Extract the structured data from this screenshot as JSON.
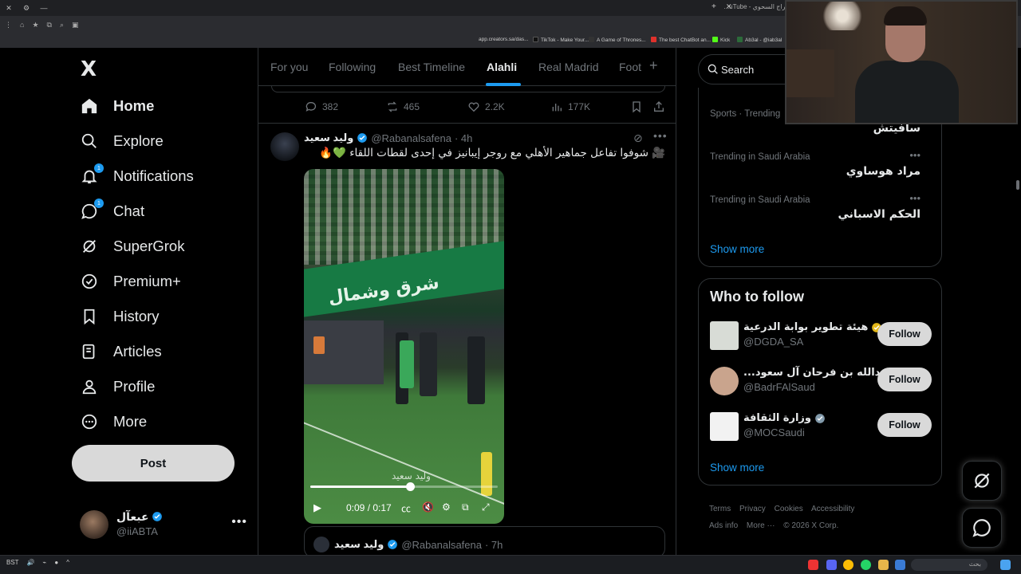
{
  "browser": {
    "window_title": "...uTube - حراج السحوي",
    "bookmarks": [
      {
        "label": "app.creators.sa/das...",
        "color": "#3b3f46"
      },
      {
        "label": "TikTok - Make Your...",
        "color": "#111111"
      },
      {
        "label": "A Game of Thrones...",
        "color": "#222222"
      },
      {
        "label": "The best ChatBot an...",
        "color": "#e0312b"
      },
      {
        "label": "Kick",
        "color": "#53fc18"
      },
      {
        "label": "Ab3al - @iab3al",
        "color": "#2c6b3a"
      }
    ]
  },
  "nav": {
    "logo": "X",
    "items": [
      {
        "label": "Home",
        "icon": "home-icon",
        "badge": ""
      },
      {
        "label": "Explore",
        "icon": "search-icon",
        "badge": ""
      },
      {
        "label": "Notifications",
        "icon": "bell-icon",
        "badge": "1"
      },
      {
        "label": "Chat",
        "icon": "chat-icon",
        "badge": "1"
      },
      {
        "label": "SuperGrok",
        "icon": "grok-icon",
        "badge": ""
      },
      {
        "label": "Premium+",
        "icon": "premium-icon",
        "badge": ""
      },
      {
        "label": "History",
        "icon": "bookmark-icon",
        "badge": ""
      },
      {
        "label": "Articles",
        "icon": "articles-icon",
        "badge": ""
      },
      {
        "label": "Profile",
        "icon": "person-icon",
        "badge": ""
      },
      {
        "label": "More",
        "icon": "more-circle-icon",
        "badge": ""
      }
    ],
    "post_label": "Post",
    "account": {
      "name": "عبعآل",
      "handle": "@iiABTA",
      "menu": "•••"
    }
  },
  "timeline": {
    "tabs": [
      "For you",
      "Following",
      "Best Timeline",
      "Alahli",
      "Real Madrid",
      "Foot"
    ],
    "active_tab": "Alahli",
    "add_tab": "+",
    "prev_actions": {
      "replies": "382",
      "reposts": "465",
      "likes": "2.2K",
      "views": "177K"
    },
    "tweet": {
      "name": "وليد سعيد",
      "handle": "@Rabanalsafena",
      "time": "· 4h",
      "text": "🎥 شوفوا تفاعل جماهير الأهلي مع روجر إيبانيز في إحدى لقطات اللقاء 💚🔥",
      "video": {
        "banner_text": "شرق وشمال",
        "watermark": "وليد سعيد",
        "time": "0:09 / 0:17",
        "progress": 0.53
      },
      "quote": {
        "name": "وليد سعيد",
        "handle": "@Rabanalsafena",
        "time": "· 7h"
      }
    }
  },
  "sidebar": {
    "search_placeholder": "Search",
    "trends": [
      {
        "meta": "Sports · Trending",
        "title": "سافيتش"
      },
      {
        "meta": "Trending in Saudi Arabia",
        "title": "مراد هوساوي"
      },
      {
        "meta": "Trending in Saudi Arabia",
        "title": "الحكم الاسباني"
      }
    ],
    "trends_show_more": "Show more",
    "who_to_follow": {
      "title": "Who to follow",
      "accounts": [
        {
          "name": "هيئة تطوير بوابة الدرعية",
          "handle": "@DGDA_SA",
          "verified_color": "#e2b719",
          "avatar_color": "#d8dcd6"
        },
        {
          "name": "...عبدالله بن فرحان آل سعود",
          "handle": "@BadrFAlSaud",
          "verified_color": "#829aab",
          "avatar_color": "#c9a48d"
        },
        {
          "name": "وزارة الثقافة",
          "handle": "@MOCSaudi",
          "verified_color": "#829aab",
          "avatar_color": "#f2f2f2"
        }
      ],
      "follow_label": "Follow",
      "show_more": "Show more"
    },
    "footer": [
      "Terms",
      "Privacy",
      "Cookies",
      "Accessibility",
      "Ads info",
      "More ···",
      "© 2026 X Corp."
    ]
  },
  "taskbar": {
    "search_text": "بحث",
    "tray": "BST"
  },
  "colors": {
    "accent": "#1d9bf0",
    "bg": "#000000",
    "border": "#2f3336",
    "muted": "#71767b"
  }
}
